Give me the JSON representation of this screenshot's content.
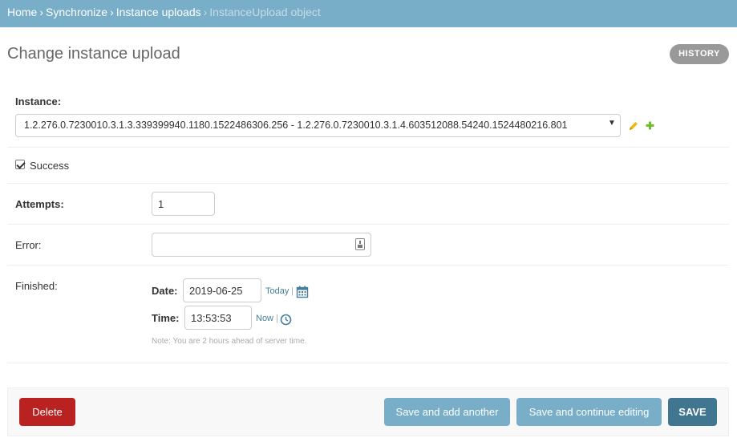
{
  "breadcrumbs": {
    "home": "Home",
    "app": "Synchronize",
    "model": "Instance uploads",
    "current": "InstanceUpload object",
    "separator": "›"
  },
  "title": "Change instance upload",
  "history_label": "HISTORY",
  "form": {
    "instance": {
      "label": "Instance:",
      "selected": "1.2.276.0.7230010.3.1.3.339399940.1180.1522486306.256 - 1.2.276.0.7230010.3.1.4.603512088.54240.1524480216.801",
      "arrow": "▼"
    },
    "success": {
      "label": "Success",
      "checked": true
    },
    "attempts": {
      "label": "Attempts:",
      "value": "1"
    },
    "error": {
      "label": "Error:",
      "value": ""
    },
    "finished": {
      "label": "Finished:",
      "date_label": "Date:",
      "date_value": "2019-06-25",
      "today_link": "Today",
      "time_label": "Time:",
      "time_value": "13:53:53",
      "now_link": "Now",
      "pipe": "|",
      "help": "Note: You are 2 hours ahead of server time."
    }
  },
  "actions": {
    "delete": "Delete",
    "save_add_another": "Save and add another",
    "save_continue": "Save and continue editing",
    "save": "SAVE"
  },
  "colors": {
    "header": "#79aec8",
    "delete": "#ba2121",
    "secondary_button": "#79aec8",
    "primary_button": "#417690",
    "link": "#447e9b"
  },
  "icons": {
    "edit": "pencil-icon",
    "add": "plus-icon",
    "date": "calendar-icon",
    "time": "clock-icon",
    "textarea": "resize-grip-icon"
  }
}
